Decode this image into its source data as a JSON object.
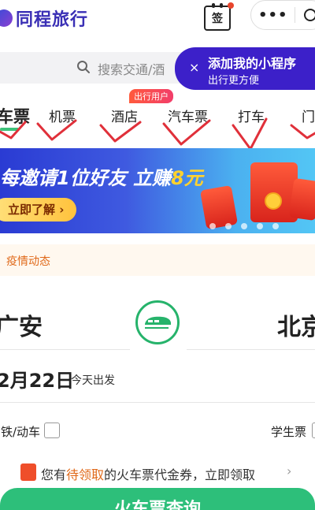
{
  "header": {
    "app_name": "同程旅行",
    "checkin_label": "签",
    "capsule_more": "•••"
  },
  "search": {
    "placeholder": "搜索交通/酒"
  },
  "tooltip": {
    "title": "添加我的小程序",
    "subtitle": "出行更方便",
    "close": "×"
  },
  "tabs": [
    {
      "label": "车票",
      "active": true
    },
    {
      "label": "机票"
    },
    {
      "label": "酒店",
      "badge": "出行用户"
    },
    {
      "label": "汽车票"
    },
    {
      "label": "打车"
    },
    {
      "label": "门"
    }
  ],
  "banner": {
    "title_prefix": "每邀请1位好友 立赚",
    "title_amount": "8元",
    "button": "立即了解 ›",
    "slides": 5
  },
  "notice": {
    "text": "疫情动态"
  },
  "route": {
    "from": "广安",
    "to": "北京"
  },
  "date": {
    "value": "2月22日",
    "note": "今天出发"
  },
  "options": {
    "high_speed_label": "高铁/动车",
    "student_label": "学生票"
  },
  "coupon": {
    "prefix": "您有",
    "highlight": "待领取",
    "suffix": "的火车票代金券，立即领取",
    "chevron": "›"
  },
  "cta": {
    "label": "火车票查询"
  },
  "colors": {
    "brand": "#3a2fb5",
    "tooltip_bg": "#3c20c9",
    "accent_green": "#2dbf7a",
    "notice_text": "#e06a1b",
    "annotation_red": "#e0303a"
  }
}
